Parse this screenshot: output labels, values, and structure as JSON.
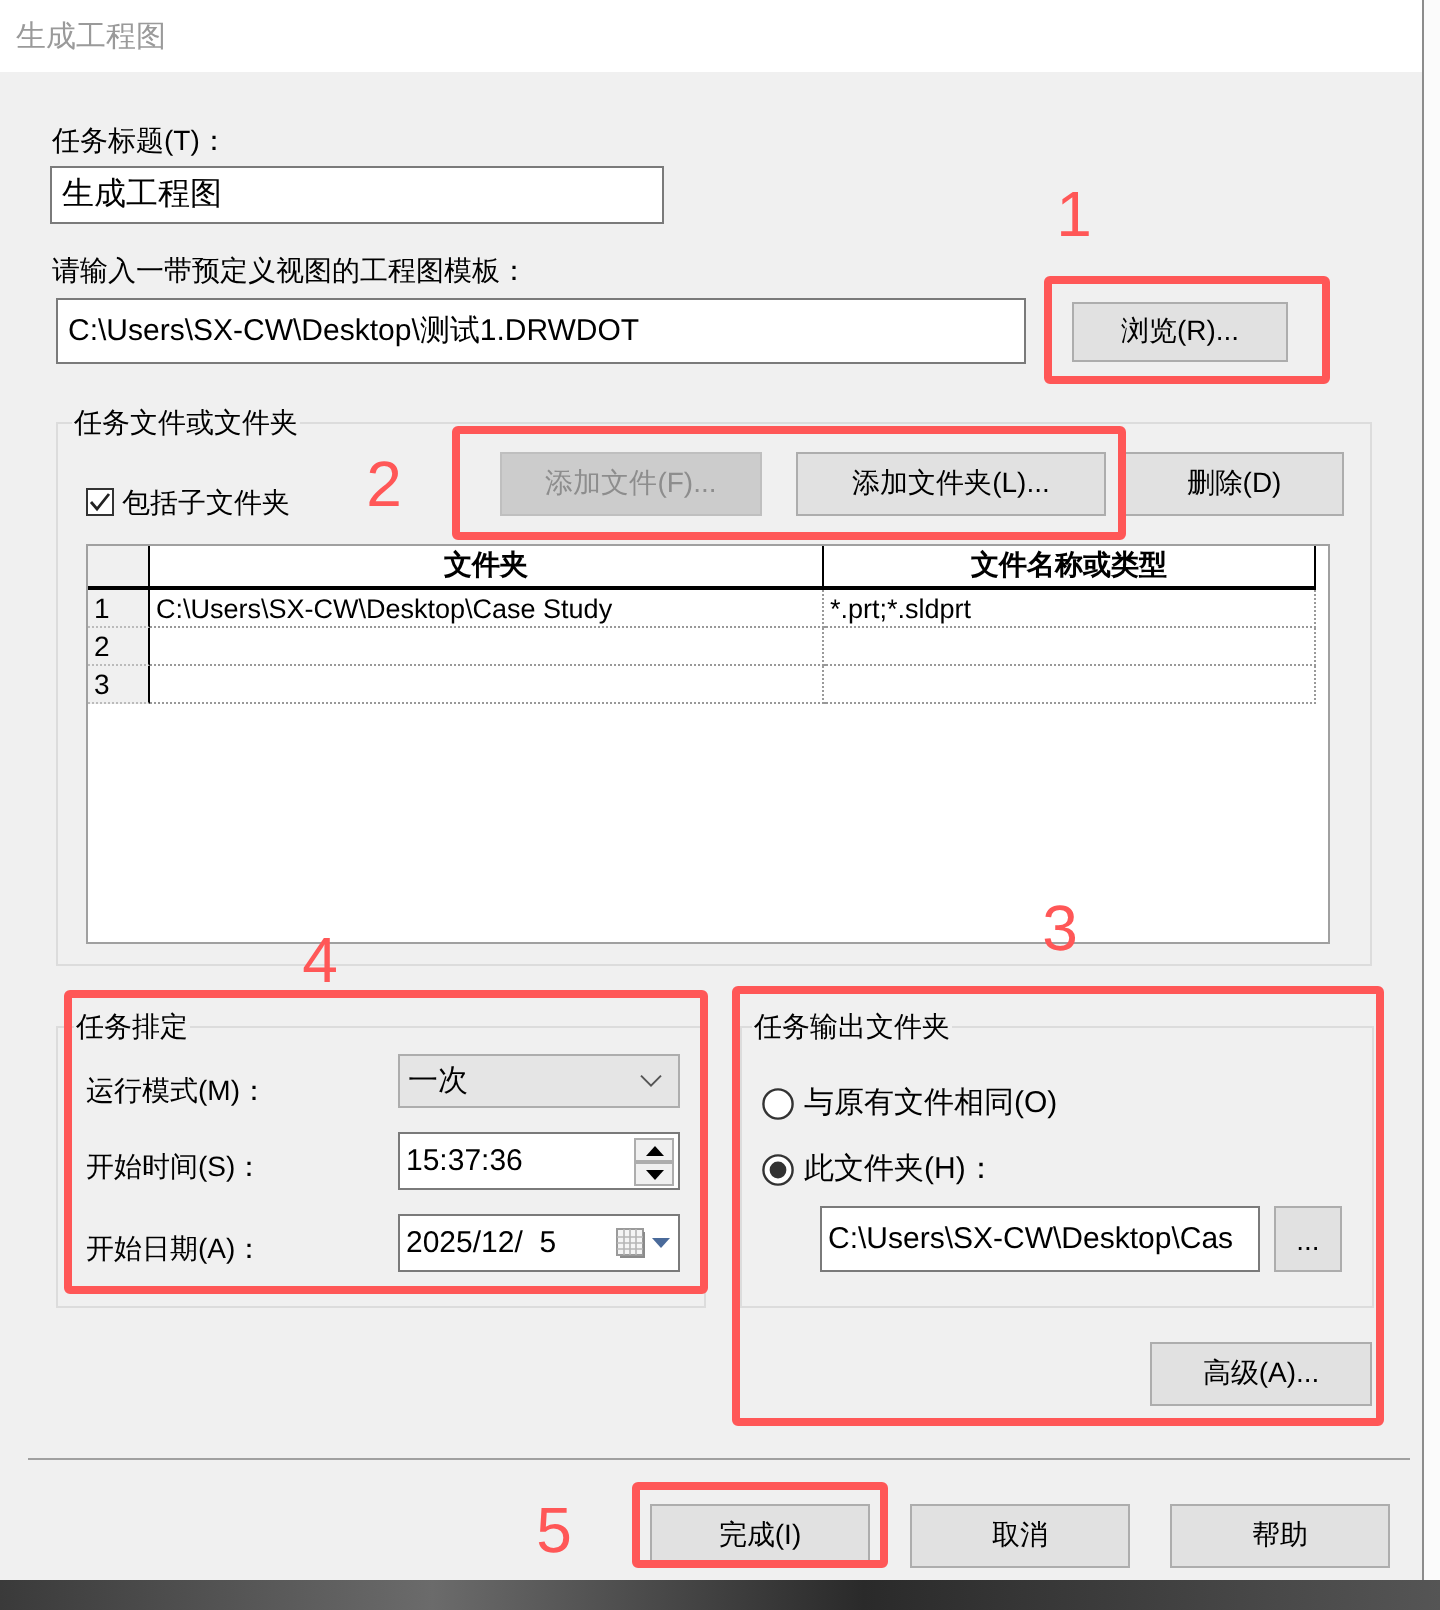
{
  "window": {
    "title": "生成工程图"
  },
  "task_title": {
    "label": "任务标题(T)：",
    "value": "生成工程图"
  },
  "template": {
    "label": "请输入一带预定义视图的工程图模板：",
    "value": "C:\\Users\\SX-CW\\Desktop\\测试1.DRWDOT",
    "browse_button": "浏览(R)..."
  },
  "files_group": {
    "title": "任务文件或文件夹",
    "include_subfolders": {
      "label": "包括子文件夹",
      "checked": true
    },
    "buttons": [
      {
        "label": "添加文件(F)...",
        "disabled": true
      },
      {
        "label": "添加文件夹(L)...",
        "disabled": false
      },
      {
        "label": "删除(D)",
        "disabled": false
      }
    ],
    "table": {
      "columns": [
        "文件夹",
        "文件名称或类型"
      ],
      "rows": [
        {
          "number": "1",
          "cells": [
            "C:\\Users\\SX-CW\\Desktop\\Case Study",
            "*.prt;*.sldprt"
          ]
        },
        {
          "number": "2"
        },
        {
          "number": "3"
        }
      ]
    }
  },
  "schedule": {
    "title": "任务排定",
    "run_mode": {
      "label": "运行模式(M)：",
      "value": "一次"
    },
    "start_time": {
      "label": "开始时间(S)：",
      "value": "15:37:36"
    },
    "start_date": {
      "label": "开始日期(A)：",
      "value": "2025/12/  5"
    }
  },
  "output_group": {
    "title": "任务输出文件夹",
    "options": [
      {
        "label": "与原有文件相同(O)",
        "selected": false
      },
      {
        "label": "此文件夹(H)：",
        "selected": true
      }
    ],
    "folder": {
      "value": "C:\\Users\\SX-CW\\Desktop\\Cas",
      "button": "..."
    },
    "advanced_button": "高级(A)..."
  },
  "footer_buttons": [
    "完成(I)",
    "取消",
    "帮助"
  ],
  "annotations": [
    {
      "label": "1"
    },
    {
      "label": "2"
    },
    {
      "label": "3"
    },
    {
      "label": "4"
    },
    {
      "label": "5"
    }
  ]
}
